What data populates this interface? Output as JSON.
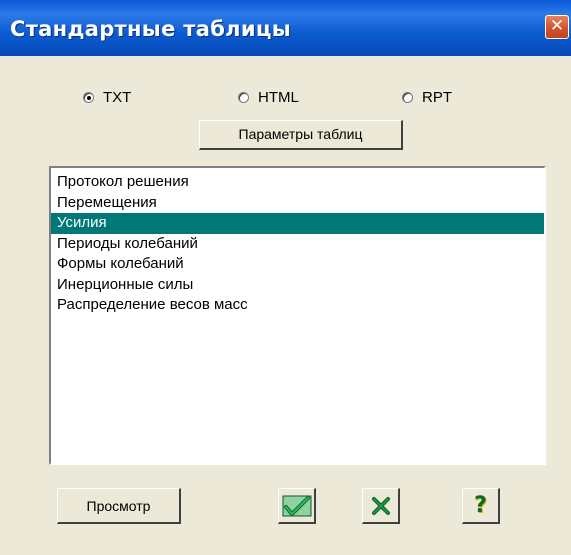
{
  "window": {
    "title": "Стандартные таблицы",
    "close_glyph": "✕"
  },
  "format": {
    "options": [
      {
        "label": "TXT",
        "checked": true
      },
      {
        "label": "HTML",
        "checked": false
      },
      {
        "label": "RPT",
        "checked": false
      }
    ]
  },
  "params_button": {
    "label": "Параметры таблиц"
  },
  "tables": {
    "items": [
      "Протокол решения",
      "Перемещения",
      "Усилия",
      "Периоды колебаний",
      "Формы колебаний",
      "Инерционные силы",
      "Распределение весов масс"
    ],
    "selected_index": 2,
    "selection_color": "#007878"
  },
  "buttons": {
    "view_label": "Просмотр",
    "ok_icon": "check-icon",
    "cancel_icon": "x-icon",
    "help_icon": "help-icon",
    "help_glyph": "?"
  },
  "colors": {
    "titlebar": "#0a5ad8",
    "dialog_bg": "#ece9d8",
    "check_green": "#1e8c3a",
    "x_green": "#0a6a2a",
    "help_yellow": "#d6a800"
  }
}
